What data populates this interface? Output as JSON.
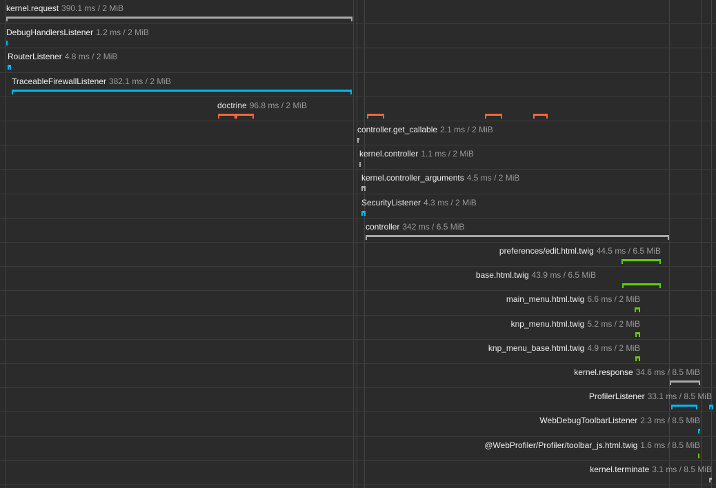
{
  "colors": {
    "background": "#2b2b2b",
    "section": "#aaaaaa",
    "event_listener": "#00b8f5",
    "doctrine": "#ff6633",
    "template": "#66cc00",
    "default": "#aaaaaa"
  },
  "events": [
    {
      "name": "kernel.request",
      "meta": "390.1 ms / 2 MiB",
      "category": "section"
    },
    {
      "name": "DebugHandlersListener",
      "meta": "1.2 ms / 2 MiB",
      "category": "event_listener"
    },
    {
      "name": "RouterListener",
      "meta": "4.8 ms / 2 MiB",
      "category": "event_listener"
    },
    {
      "name": "TraceableFirewallListener",
      "meta": "382.1 ms / 2 MiB",
      "category": "event_listener"
    },
    {
      "name": "doctrine",
      "meta": "96.8 ms / 2 MiB",
      "category": "doctrine"
    },
    {
      "name": "controller.get_callable",
      "meta": "2.1 ms / 2 MiB",
      "category": "default"
    },
    {
      "name": "kernel.controller",
      "meta": "1.1 ms / 2 MiB",
      "category": "default"
    },
    {
      "name": "kernel.controller_arguments",
      "meta": "4.5 ms / 2 MiB",
      "category": "default"
    },
    {
      "name": "SecurityListener",
      "meta": "4.3 ms / 2 MiB",
      "category": "event_listener"
    },
    {
      "name": "controller",
      "meta": "342 ms / 6.5 MiB",
      "category": "section"
    },
    {
      "name": "preferences/edit.html.twig",
      "meta": "44.5 ms / 6.5 MiB",
      "category": "template"
    },
    {
      "name": "base.html.twig",
      "meta": "43.9 ms / 6.5 MiB",
      "category": "template"
    },
    {
      "name": "main_menu.html.twig",
      "meta": "6.6 ms / 2 MiB",
      "category": "template"
    },
    {
      "name": "knp_menu.html.twig",
      "meta": "5.2 ms / 2 MiB",
      "category": "template"
    },
    {
      "name": "knp_menu_base.html.twig",
      "meta": "4.9 ms / 2 MiB",
      "category": "template"
    },
    {
      "name": "kernel.response",
      "meta": "34.6 ms / 8.5 MiB",
      "category": "section"
    },
    {
      "name": "ProfilerListener",
      "meta": "33.1 ms / 8.5 MiB",
      "category": "event_listener"
    },
    {
      "name": "WebDebugToolbarListener",
      "meta": "2.3 ms / 8.5 MiB",
      "category": "event_listener"
    },
    {
      "name": "@WebProfiler/Profiler/toolbar_js.html.twig",
      "meta": "1.6 ms / 8.5 MiB",
      "category": "template"
    },
    {
      "name": "kernel.terminate",
      "meta": "3.1 ms / 8.5 MiB",
      "category": "default"
    }
  ]
}
